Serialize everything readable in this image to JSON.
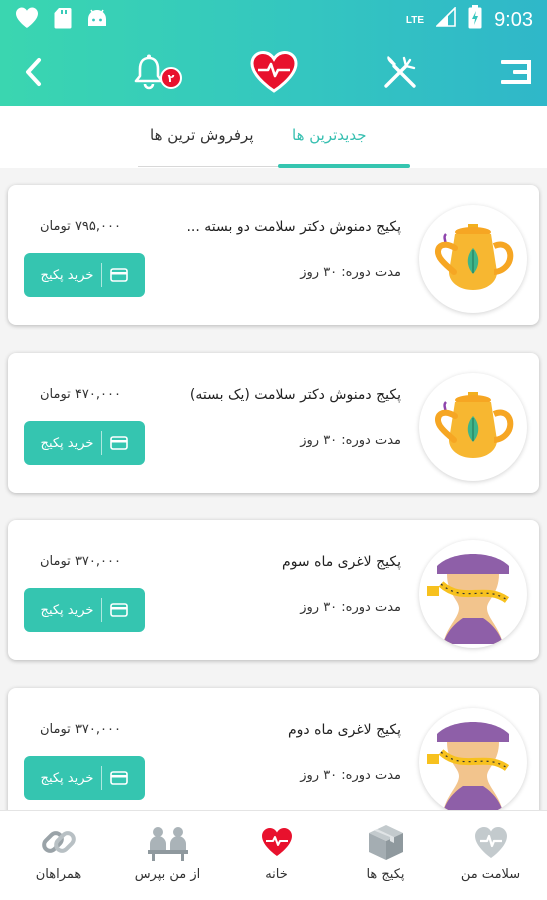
{
  "status_bar": {
    "time": "9:03",
    "network": "LTE"
  },
  "toolbar": {
    "notification_count": "۲"
  },
  "tabs": [
    {
      "label": "جدیدترین ها",
      "active": true
    },
    {
      "label": "پرفروش ترین ها",
      "active": false
    }
  ],
  "packages": [
    {
      "title": "پکیج دمنوش دکتر سلامت دو بسته ...",
      "price": "۷۹۵,۰۰۰ تومان",
      "duration": "مدت دوره: ۳۰ روز",
      "buy_label": "خرید پکیج",
      "image": "teapot-icon"
    },
    {
      "title": "پکیج دمنوش دکتر سلامت (یک بسته)",
      "price": "۴۷۰,۰۰۰ تومان",
      "duration": "مدت دوره: ۳۰ روز",
      "buy_label": "خرید پکیج",
      "image": "teapot-icon"
    },
    {
      "title": "پکیج لاغری ماه سوم",
      "price": "۳۷۰,۰۰۰ تومان",
      "duration": "مدت دوره: ۳۰ روز",
      "buy_label": "خرید پکیج",
      "image": "waist-measure-icon"
    },
    {
      "title": "پکیج لاغری ماه دوم",
      "price": "۳۷۰,۰۰۰ تومان",
      "duration": "مدت دوره: ۳۰ روز",
      "buy_label": "خرید پکیج",
      "image": "waist-measure-icon"
    }
  ],
  "bottom_nav": [
    {
      "label": "همراهان",
      "icon": "chain-link-icon"
    },
    {
      "label": "از من بپرس",
      "icon": "consult-icon"
    },
    {
      "label": "خانه",
      "icon": "heart-icon"
    },
    {
      "label": "پکیج ها",
      "icon": "box-icon"
    },
    {
      "label": "سلامت من",
      "icon": "health-icon"
    }
  ],
  "colors": {
    "accent": "#35c5b0",
    "badge": "#e8112d",
    "heart": "#e8112d"
  }
}
